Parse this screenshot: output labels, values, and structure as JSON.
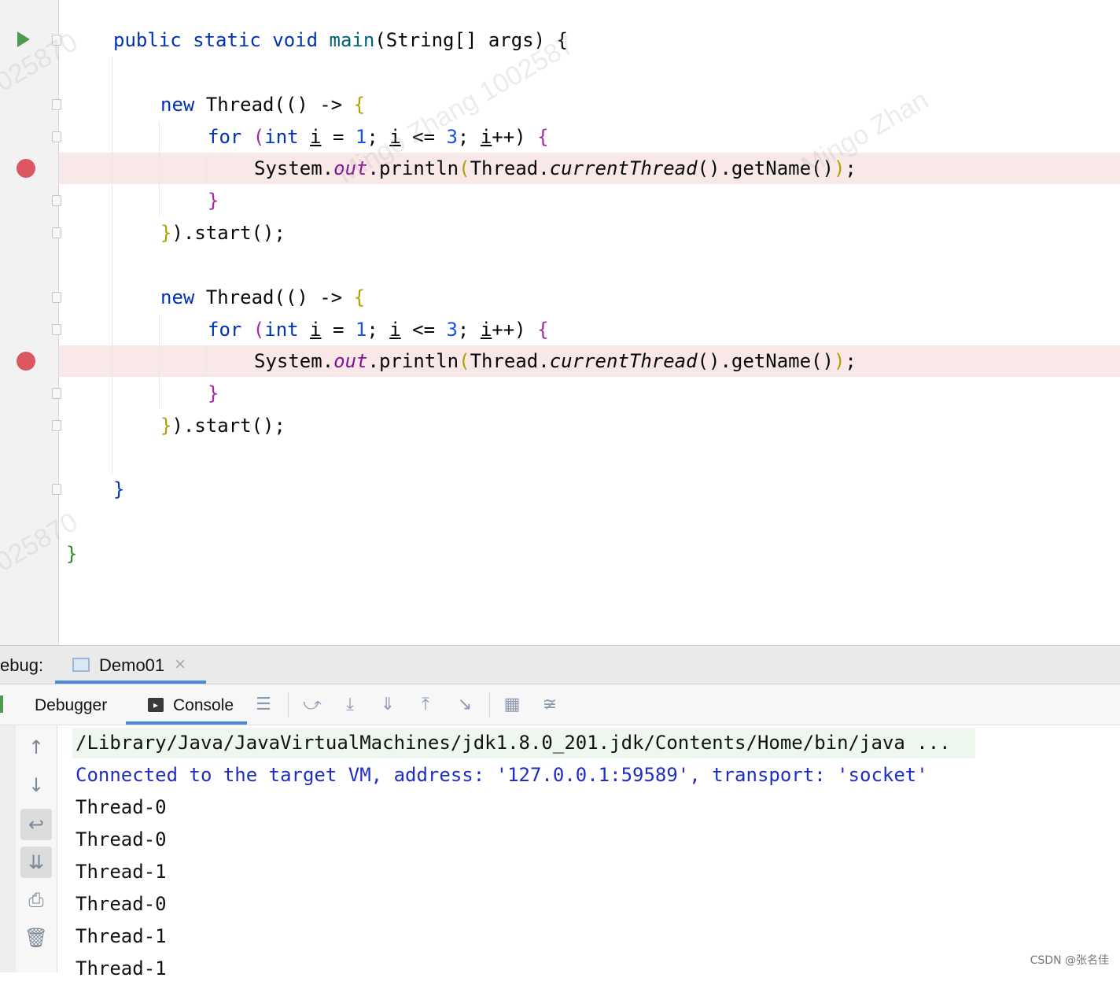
{
  "editor": {
    "lines": {
      "l1": {
        "a": "public static void ",
        "b": "main",
        "c": "(String[] args) {"
      },
      "t1_new": {
        "kw": "new ",
        "rest": "Thread(() -> ",
        "br": "{"
      },
      "t1_for": {
        "kw": "for ",
        "p1": "(",
        "kw2": "int ",
        "v1": "i",
        "eq": " = ",
        "n1": "1",
        "sc": "; ",
        "v2": "i",
        "le": " <= ",
        "n2": "3",
        "sc2": "; ",
        "v3": "i",
        "pp": "++) ",
        "br": "{"
      },
      "t1_print": {
        "a": "System.",
        "out": "out",
        "b": ".println",
        "p": "(",
        "c": "Thread.",
        "cur": "currentThread",
        "d": "().getName()",
        "p2": ")",
        "e": ";"
      },
      "t1_close_for": "}",
      "t1_start": {
        "br": "}",
        "rest": ").start();"
      },
      "t2_new": {
        "kw": "new ",
        "rest": "Thread(() -> ",
        "br": "{"
      },
      "t2_for": {
        "kw": "for ",
        "p1": "(",
        "kw2": "int ",
        "v1": "i",
        "eq": " = ",
        "n1": "1",
        "sc": "; ",
        "v2": "i",
        "le": " <= ",
        "n2": "3",
        "sc2": "; ",
        "v3": "i",
        "pp": "++) ",
        "br": "{"
      },
      "t2_print": {
        "a": "System.",
        "out": "out",
        "b": ".println",
        "p": "(",
        "c": "Thread.",
        "cur": "currentThread",
        "d": "().getName()",
        "p2": ")",
        "e": ";"
      },
      "t2_close_for": "}",
      "t2_start": {
        "br": "}",
        "rest": ").start();"
      },
      "main_close": "}",
      "class_close": "}"
    },
    "watermark": {
      "w1": "025870",
      "w2": "Mingo Zhang 1002587",
      "w3": "Mingo Zhan",
      "w4": "025870"
    }
  },
  "debug": {
    "label": "ebug:",
    "tab": "Demo01",
    "close": "×"
  },
  "toolbar": {
    "debugger": "Debugger",
    "console": "Console"
  },
  "console": {
    "path": "/Library/Java/JavaVirtualMachines/jdk1.8.0_201.jdk/Contents/Home/bin/java ...",
    "connected": "Connected to the target VM, address: '127.0.0.1:59589', transport: 'socket'",
    "output": [
      "Thread-0",
      "Thread-0",
      "Thread-1",
      "Thread-0",
      "Thread-1",
      "Thread-1"
    ]
  },
  "footer": {
    "credit": "CSDN @张名佳"
  },
  "colors": {
    "keyword": "#0033b3",
    "breakpoint": "#db5860",
    "accent": "#4a89dc"
  },
  "icons": [
    "run-icon",
    "breakpoint-icon",
    "fold-icon",
    "console-icon",
    "restore-layout-icon",
    "step-over-icon",
    "step-into-icon",
    "force-step-into-icon",
    "step-out-icon",
    "run-to-cursor-icon",
    "evaluate-icon",
    "trace-icon",
    "up-arrow-icon",
    "down-arrow-icon",
    "soft-wrap-icon",
    "scroll-to-end-icon",
    "print-icon",
    "trash-icon"
  ]
}
